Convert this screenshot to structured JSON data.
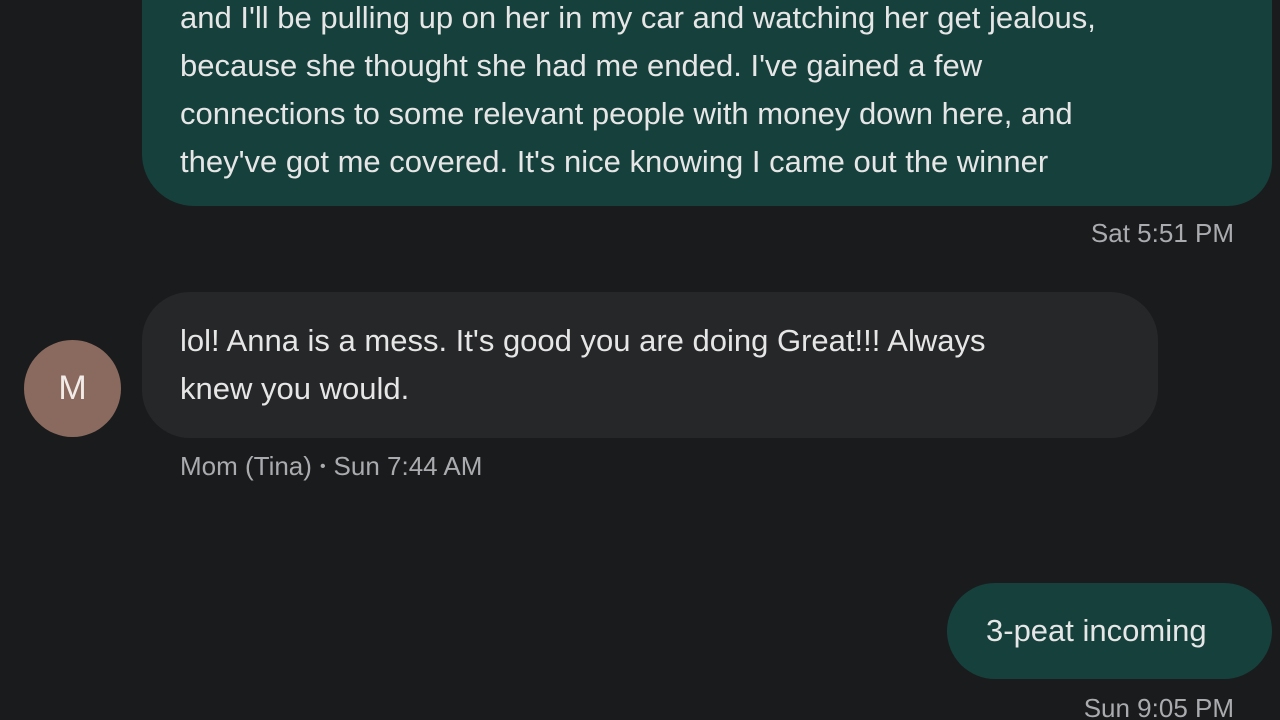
{
  "messages": [
    {
      "direction": "outgoing",
      "lines": [
        "and I'll be pulling up on her in my car and watching her get jealous,",
        "because she thought she had me ended. I've gained a few",
        "connections to some relevant people with money down here, and",
        "they've got me covered. It's nice knowing I came out the winner"
      ],
      "timestamp": "Sat 5:51 PM"
    },
    {
      "direction": "incoming",
      "avatar_initial": "M",
      "lines": [
        "lol!  Anna is a mess.    It's good you are doing Great!!! Always",
        "knew you would."
      ],
      "sender": "Mom (Tina)",
      "separator": "•",
      "timestamp": "Sun 7:44 AM"
    },
    {
      "direction": "outgoing",
      "lines": [
        "3-peat incoming"
      ],
      "timestamp": "Sun 9:05 PM"
    }
  ],
  "colors": {
    "background": "#1a1b1d",
    "outgoing_bubble": "#16403c",
    "incoming_bubble": "#262729",
    "avatar": "#8a6a5e",
    "text": "#e6e6e6",
    "meta_text": "#a9abae"
  }
}
